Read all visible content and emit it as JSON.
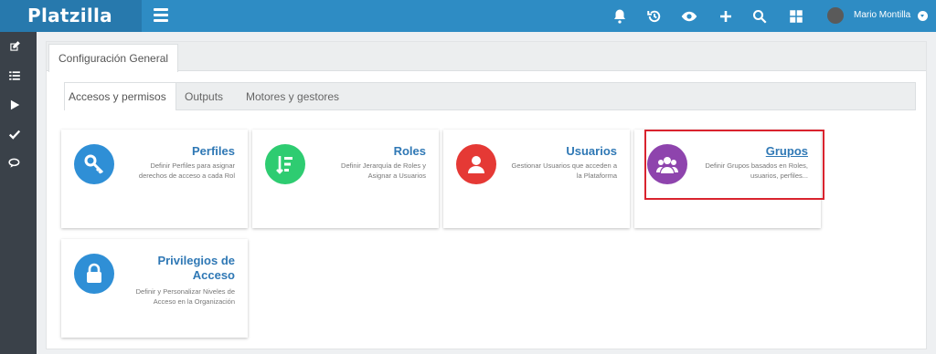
{
  "app": {
    "brand": "Platzilla"
  },
  "header": {
    "icons": [
      "bell-icon",
      "history-icon",
      "eye-icon",
      "plus-icon",
      "search-icon",
      "grid-icon"
    ],
    "user_name": "Mario Montilla"
  },
  "sidebar": {
    "icons": [
      "edit-icon",
      "list-icon",
      "play-icon",
      "check-icon",
      "chat-icon"
    ]
  },
  "main": {
    "page_tab": "Configuración General",
    "tabs": [
      {
        "label": "Accesos y permisos"
      },
      {
        "label": "Outputs"
      },
      {
        "label": "Motores y gestores"
      }
    ],
    "cards": [
      {
        "title": "Perfiles",
        "desc": "Definir Perfiles para asignar derechos de acceso a cada Rol",
        "icon": "key-icon",
        "color": "#2f8fd6"
      },
      {
        "title": "Roles",
        "desc": "Definir Jerarquía de Roles y Asignar a Usuarios",
        "icon": "hierarchy-icon",
        "color": "#2ecc71"
      },
      {
        "title": "Usuarios",
        "desc": "Gestionar Usuarios que acceden a la Plataforma",
        "icon": "user-icon",
        "color": "#e53935"
      },
      {
        "title": "Grupos",
        "desc": "Definir Grupos basados en Roles, usuarios, perfiles...",
        "icon": "users-icon",
        "color": "#8e44ad"
      },
      {
        "title": "Privilegios de Acceso",
        "desc": "Definir y Personalizar Niveles de Acceso en la Organización",
        "icon": "lock-icon",
        "color": "#2f8fd6"
      }
    ]
  }
}
